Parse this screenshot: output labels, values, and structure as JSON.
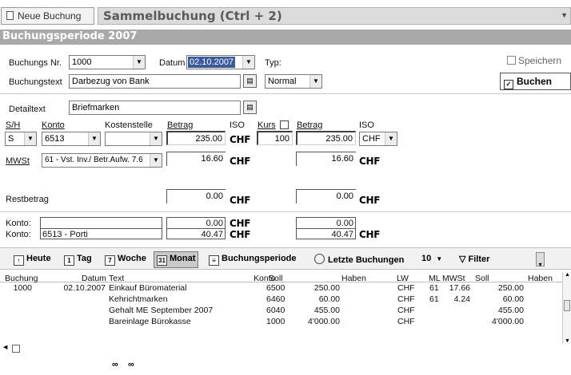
{
  "header": {
    "new_booking_label": "Neue Buchung",
    "title": "Sammelbuchung (Ctrl + 2)",
    "period_label": "Buchungsperiode 2007"
  },
  "form": {
    "booking_nr_label": "Buchungs Nr.",
    "booking_nr_value": "1000",
    "date_label": "Datum",
    "date_value": "02.10.2007",
    "type_label": "Typ:",
    "booking_text_label": "Buchungstext",
    "booking_text_value": "Darbezug von Bank",
    "type_value": "Normal",
    "save_label": "Speichern",
    "book_label": "Buchen",
    "detail_text_label": "Detailtext",
    "detail_text_value": "Briefmarken",
    "sh_label": "S/H",
    "konto_label": "Konto",
    "kostenstelle_label": "Kostenstelle",
    "betrag_label": "Betrag",
    "iso_label": "ISO",
    "kurs_label": "Kurs",
    "betrag2_label": "Betrag",
    "iso2_label": "ISO",
    "sh_value": "S",
    "konto_value": "6513",
    "betrag_value": "235.00",
    "currency": "CHF",
    "kurs_value": "100",
    "betrag2_value": "235.00",
    "iso2_value": "CHF",
    "mwst_label": "MWSt",
    "mwst_value": "61 - Vst. Inv./ Betr.Aufw. 7.6",
    "mwst_amount": "16.60",
    "mwst_amount2": "16.60",
    "rest_label": "Restbetrag",
    "rest_value": "0.00",
    "rest_value2": "0.00",
    "konto1_label": "Konto:",
    "konto2_label": "Konto:",
    "konto1_amount": "0.00",
    "konto1_amount2": "0.00",
    "konto2_value": "6513 - Porti",
    "konto2_amount": "40.47",
    "konto2_amount2": "40.47"
  },
  "toolbar": {
    "heute": "Heute",
    "tag": "Tag",
    "woche": "Woche",
    "monat": "Monat",
    "periode": "Buchungsperiode",
    "letzte": "Letzte Buchungen",
    "count": "10",
    "filter": "Filter"
  },
  "table": {
    "headers": [
      "Buchung",
      "Datum",
      "Text",
      "Konto",
      "Soll",
      "Haben",
      "LW",
      "ML",
      "MWSt",
      "Soll",
      "Haben"
    ],
    "rows": [
      {
        "buchung": "1000",
        "datum": "02.10.2007",
        "text": "Einkauf Büromaterial",
        "konto": "6500",
        "soll": "250.00",
        "lw": "CHF",
        "ml": "61",
        "mwst": "17.66",
        "soll2": "250.00"
      },
      {
        "buchung": "",
        "datum": "",
        "text": "Kehrichtmarken",
        "konto": "6460",
        "soll": "60.00",
        "lw": "CHF",
        "ml": "61",
        "mwst": "4.24",
        "soll2": "60.00"
      },
      {
        "buchung": "",
        "datum": "",
        "text": "Gehalt ME September 2007",
        "konto": "6040",
        "soll": "455.00",
        "lw": "CHF",
        "ml": "",
        "mwst": "",
        "soll2": "455.00"
      },
      {
        "buchung": "",
        "datum": "",
        "text": "Bareinlage Bürokasse",
        "konto": "1000",
        "soll": "4'000.00",
        "lw": "CHF",
        "ml": "",
        "mwst": "",
        "soll2": "4'000.00"
      }
    ]
  },
  "icons": {
    "binoculars": "binoculars-icon",
    "binoculars_next": "binoculars-next-icon"
  }
}
